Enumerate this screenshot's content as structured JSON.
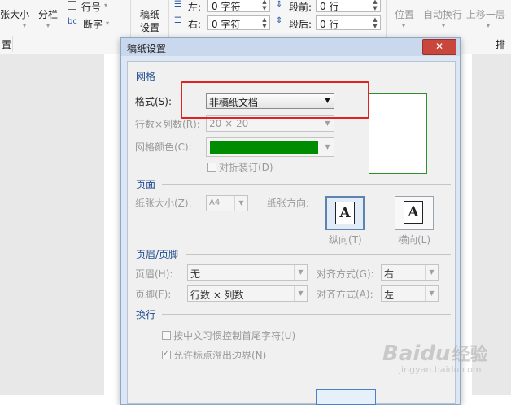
{
  "ribbon": {
    "paper_size": "张大小",
    "columns": "分栏",
    "line_number": "行号",
    "hyphenation": "断字",
    "grid_paper_line1": "稿纸",
    "grid_paper_line2": "设置",
    "group_label_left": "置",
    "indent_left_label": "左:",
    "indent_left_value": "0 字符",
    "indent_right_label": "右:",
    "indent_right_value": "0 字符",
    "spacing_before_label": "段前:",
    "spacing_before_value": "0 行",
    "spacing_after_label": "段后:",
    "spacing_after_value": "0 行",
    "position": "位置",
    "wrap_text": "自动换行",
    "bring_forward": "上移一层",
    "group_label_right": "排"
  },
  "dialog": {
    "title": "稿纸设置",
    "close": "✕",
    "grid_section": "网格",
    "style_label": "格式(S):",
    "style_value": "非稿纸文档",
    "rows_cols_label": "行数×列数(R):",
    "rows_cols_value": "20 × 20",
    "grid_color_label": "网格颜色(C):",
    "fold_label": "对折装订(D)",
    "page_section": "页面",
    "paper_size_label": "纸张大小(Z):",
    "paper_size_value": "A4",
    "orientation_label": "纸张方向:",
    "portrait_label": "纵向(T)",
    "landscape_label": "横向(L)",
    "orientation_glyph": "A",
    "header_footer_section": "页眉/页脚",
    "header_label": "页眉(H):",
    "header_value": "无",
    "header_align_label": "对齐方式(G):",
    "header_align_value": "右",
    "footer_label": "页脚(F):",
    "footer_value": "行数 × 列数",
    "footer_align_label": "对齐方式(A):",
    "footer_align_value": "左",
    "linebreak_section": "换行",
    "chinese_rule_label": "按中文习惯控制首尾字符(U)",
    "allow_punct_label": "允许标点溢出边界(N)"
  },
  "watermark": {
    "brand": "Baidu",
    "cn": "经验",
    "url": "jingyan.baidu.com"
  },
  "colors": {
    "grid_color": "#008c00",
    "highlight": "#e0231e",
    "section_text": "#1e4a8f"
  }
}
